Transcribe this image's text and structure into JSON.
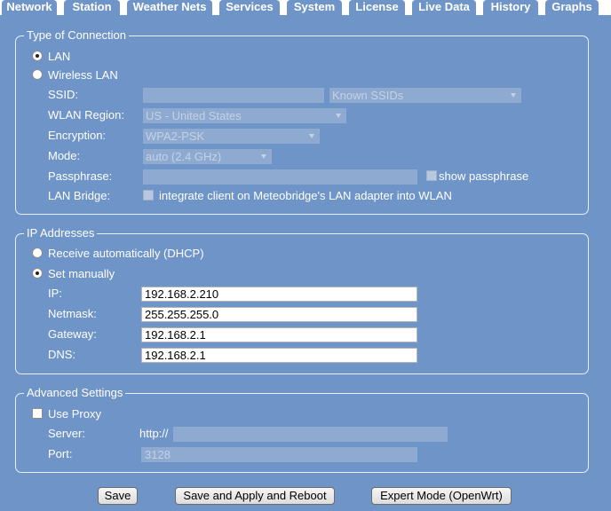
{
  "tabs": [
    "Network",
    "Station",
    "Weather Nets",
    "Services",
    "System",
    "License",
    "Live Data",
    "History",
    "Graphs"
  ],
  "active_tab": "Network",
  "connection": {
    "legend": "Type of Connection",
    "lan_label": "LAN",
    "wireless_label": "Wireless LAN",
    "selected": "LAN",
    "ssid_label": "SSID:",
    "ssid_value": "",
    "known_ssids": "Known SSIDs",
    "region_label": "WLAN Region:",
    "region_value": "US - United States",
    "encryption_label": "Encryption:",
    "encryption_value": "WPA2-PSK",
    "mode_label": "Mode:",
    "mode_value": "auto (2.4 GHz)",
    "passphrase_label": "Passphrase:",
    "passphrase_value": "",
    "show_passphrase": "show passphrase",
    "bridge_label": "LAN Bridge:",
    "bridge_text": "integrate client on Meteobridge's LAN adapter into WLAN"
  },
  "ip": {
    "legend": "IP Addresses",
    "dhcp_label": "Receive automatically (DHCP)",
    "manual_label": "Set manually",
    "selected": "manual",
    "ip_label": "IP:",
    "ip_value": "192.168.2.210",
    "netmask_label": "Netmask:",
    "netmask_value": "255.255.255.0",
    "gateway_label": "Gateway:",
    "gateway_value": "192.168.2.1",
    "dns_label": "DNS:",
    "dns_value": "192.168.2.1"
  },
  "advanced": {
    "legend": "Advanced Settings",
    "proxy_label": "Use Proxy",
    "server_label": "Server:",
    "server_prefix": "http://",
    "server_value": "",
    "port_label": "Port:",
    "port_value": "3128"
  },
  "buttons": {
    "save": "Save",
    "save_apply": "Save and Apply and Reboot",
    "expert": "Expert Mode (OpenWrt)"
  },
  "colors": {
    "background": "#6f94c8",
    "disabled_field": "#8faad1",
    "text": "#ffffff"
  }
}
